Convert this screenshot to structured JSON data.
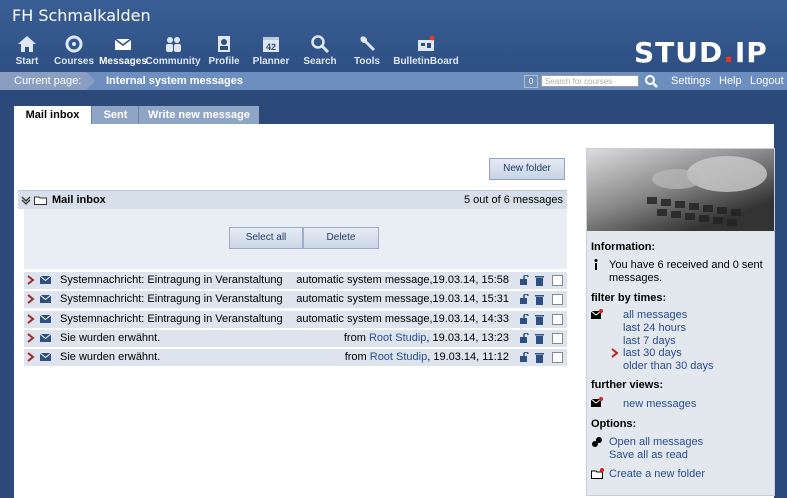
{
  "header": {
    "institution": "FH Schmalkalden",
    "logo_main": "STUD",
    "logo_dot": ".",
    "logo_end": "IP",
    "nav": [
      {
        "label": "Start",
        "icon": "home-icon"
      },
      {
        "label": "Courses",
        "icon": "courses-icon"
      },
      {
        "label": "Messages",
        "icon": "envelope-icon"
      },
      {
        "label": "Community",
        "icon": "community-icon"
      },
      {
        "label": "Profile",
        "icon": "profile-icon"
      },
      {
        "label": "Planner",
        "icon": "calendar-icon",
        "badge": "42"
      },
      {
        "label": "Search",
        "icon": "search-icon"
      },
      {
        "label": "Tools",
        "icon": "wrench-icon"
      },
      {
        "label": "BulletinBoard",
        "icon": "bulletinboard-icon"
      }
    ]
  },
  "subbar": {
    "current_page_label": "Current page:",
    "current_page": "Internal system messages",
    "counter": "0",
    "search_placeholder": "Search for courses",
    "links": [
      "Settings",
      "Help",
      "Logout"
    ]
  },
  "tabs": [
    "Mail inbox",
    "Sent",
    "Write new message"
  ],
  "main": {
    "new_folder": "New folder",
    "inbox_title": "Mail inbox",
    "inbox_count": "5 out of 6 messages",
    "select_all": "Select all",
    "delete": "Delete",
    "messages": [
      {
        "subject": "Systemnachricht: Eintragung in Veranstaltung",
        "from_prefix": "",
        "author": "",
        "meta": "automatic system message,19.03.14, 15:58"
      },
      {
        "subject": "Systemnachricht: Eintragung in Veranstaltung",
        "from_prefix": "",
        "author": "",
        "meta": "automatic system message,19.03.14, 15:31"
      },
      {
        "subject": "Systemnachricht: Eintragung in Veranstaltung",
        "from_prefix": "",
        "author": "",
        "meta": "automatic system message,19.03.14, 14:33"
      },
      {
        "subject": "Sie wurden erwähnt.",
        "from_prefix": "from ",
        "author": "Root Studip",
        "meta": ", 19.03.14, 13:23"
      },
      {
        "subject": "Sie wurden erwähnt.",
        "from_prefix": "from ",
        "author": "Root Studip",
        "meta": ", 19.03.14, 11:12"
      }
    ]
  },
  "sidebar": {
    "information_heading": "Information:",
    "information_text": "You have 6 received and 0 sent messages.",
    "filter_heading": "filter by times:",
    "filters": [
      "all messages",
      "last 24 hours",
      "last 7 days",
      "last 30 days",
      "older than 30 days"
    ],
    "further_heading": "further views:",
    "new_messages": "new messages",
    "options_heading": "Options:",
    "open_all": "Open all messages",
    "save_all": "Save all as read",
    "create_folder": "Create a new folder"
  }
}
